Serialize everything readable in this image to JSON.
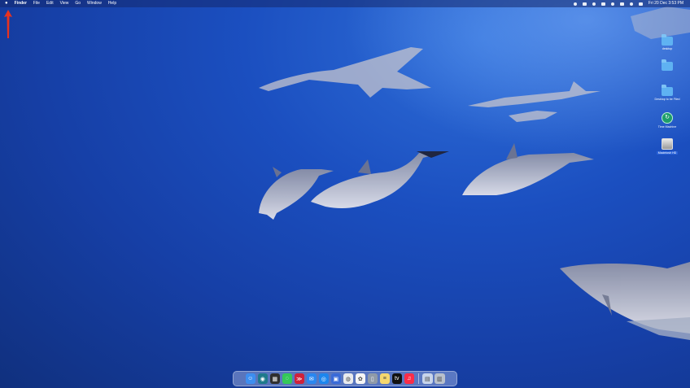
{
  "menubar": {
    "apple": "",
    "items": [
      "Finder",
      "File",
      "Edit",
      "View",
      "Go",
      "Window",
      "Help"
    ],
    "clock": "Fri 20 Dec  3:53 PM"
  },
  "desktop_icons": [
    {
      "label": "desktop",
      "icon": "folder-icon"
    },
    {
      "label": "",
      "icon": "folder-icon"
    },
    {
      "label": "Desktop to be Filed",
      "icon": "folder-icon"
    },
    {
      "label": "Time Machine",
      "icon": "time-machine-icon"
    },
    {
      "label": "Macintosh HD",
      "icon": "hard-drive-icon"
    }
  ],
  "dock": {
    "apps": [
      {
        "name": "finder-icon",
        "color": "#3d8ef0",
        "glyph": "☺"
      },
      {
        "name": "launchpad-icon",
        "color": "#1f7a8c",
        "glyph": "◉"
      },
      {
        "name": "photo-booth-icon",
        "color": "#2f2f2f",
        "glyph": "▦"
      },
      {
        "name": "messages-icon",
        "color": "#34c759",
        "glyph": "◌"
      },
      {
        "name": "speedify-icon",
        "color": "#d0213a",
        "glyph": "≫"
      },
      {
        "name": "mail-icon",
        "color": "#2a87f0",
        "glyph": "✉"
      },
      {
        "name": "safari-icon",
        "color": "#1c86ee",
        "glyph": "◎"
      },
      {
        "name": "screen-capture-icon",
        "color": "#3a6bd8",
        "glyph": "▣"
      },
      {
        "name": "chrome-icon",
        "color": "#e8eaed",
        "glyph": "◍"
      },
      {
        "name": "photos-icon",
        "color": "#f5f5f5",
        "glyph": "✿"
      },
      {
        "name": "iphone-mirroring-icon",
        "color": "#8f9aa8",
        "glyph": "▯"
      },
      {
        "name": "notes-icon",
        "color": "#f5d76e",
        "glyph": "≡"
      },
      {
        "name": "apple-tv-icon",
        "color": "#111111",
        "glyph": "tv"
      },
      {
        "name": "music-icon",
        "color": "#fa2d48",
        "glyph": "♫"
      },
      {
        "name": "downloads-stack-icon",
        "color": "#c7d4ea",
        "glyph": "▤"
      },
      {
        "name": "trash-icon",
        "color": "#b8c0cc",
        "glyph": "▥"
      }
    ]
  }
}
